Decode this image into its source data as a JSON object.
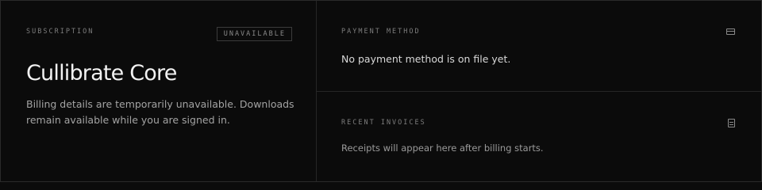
{
  "subscription": {
    "eyebrow": "SUBSCRIPTION",
    "status_badge": "UNAVAILABLE",
    "plan_name": "Cullibrate Core",
    "description": "Billing details are temporarily unavailable. Downloads remain available while you are signed in."
  },
  "payment_method": {
    "eyebrow": "PAYMENT METHOD",
    "icon": "credit-card-icon",
    "message": "No payment method is on file yet."
  },
  "recent_invoices": {
    "eyebrow": "RECENT INVOICES",
    "icon": "document-icon",
    "message": "Receipts will appear here after billing starts."
  },
  "colors": {
    "background": "#0b0b0b",
    "border": "#262626",
    "muted_text": "#7d7d7d",
    "primary_text": "#f2f2f2"
  }
}
